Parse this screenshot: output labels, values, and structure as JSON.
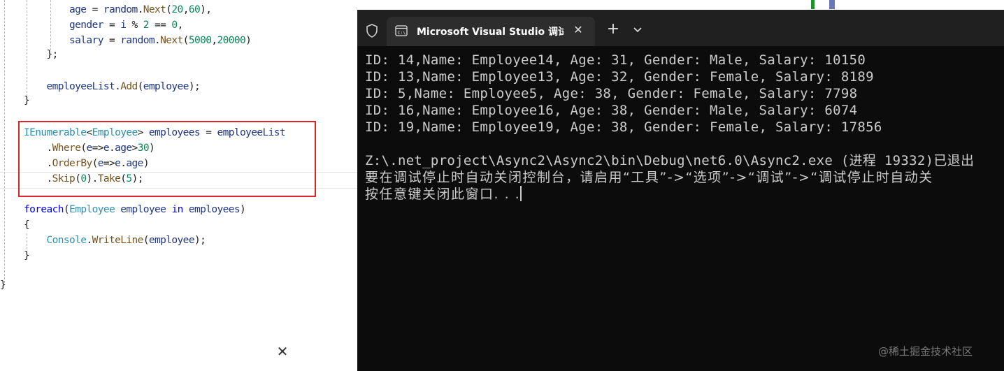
{
  "editor": {
    "lines": [
      {
        "indent": "        ",
        "parts": [
          [
            "var",
            "age"
          ],
          [
            "punc",
            " = "
          ],
          [
            "var",
            "random"
          ],
          [
            "punc",
            "."
          ],
          [
            "method",
            "Next"
          ],
          [
            "punc",
            "("
          ],
          [
            "num",
            "20"
          ],
          [
            "punc",
            ","
          ],
          [
            "num",
            "60"
          ],
          [
            "punc",
            "),"
          ]
        ]
      },
      {
        "indent": "        ",
        "parts": [
          [
            "var",
            "gender"
          ],
          [
            "punc",
            " = "
          ],
          [
            "var",
            "i"
          ],
          [
            "punc",
            " % "
          ],
          [
            "num",
            "2"
          ],
          [
            "punc",
            " == "
          ],
          [
            "num",
            "0"
          ],
          [
            "punc",
            ","
          ]
        ]
      },
      {
        "indent": "        ",
        "parts": [
          [
            "var",
            "salary"
          ],
          [
            "punc",
            " = "
          ],
          [
            "var",
            "random"
          ],
          [
            "punc",
            "."
          ],
          [
            "method",
            "Next"
          ],
          [
            "punc",
            "("
          ],
          [
            "num",
            "5000"
          ],
          [
            "punc",
            ","
          ],
          [
            "num",
            "20000"
          ],
          [
            "punc",
            ")"
          ]
        ]
      },
      {
        "indent": "    ",
        "parts": [
          [
            "punc",
            "};"
          ]
        ]
      },
      {
        "indent": "",
        "parts": []
      },
      {
        "indent": "    ",
        "parts": [
          [
            "var",
            "employeeList"
          ],
          [
            "punc",
            "."
          ],
          [
            "method",
            "Add"
          ],
          [
            "punc",
            "("
          ],
          [
            "var",
            "employee"
          ],
          [
            "punc",
            ");"
          ]
        ]
      },
      {
        "indent": "",
        "parts": [
          [
            "punc",
            "}"
          ]
        ]
      },
      {
        "indent": "",
        "parts": []
      },
      {
        "indent": "",
        "parts": [
          [
            "type",
            "IEnumerable"
          ],
          [
            "punc",
            "<"
          ],
          [
            "type",
            "Employee"
          ],
          [
            "punc",
            "> "
          ],
          [
            "var",
            "employees"
          ],
          [
            "punc",
            " = "
          ],
          [
            "var",
            "employeeList"
          ]
        ]
      },
      {
        "indent": "    ",
        "parts": [
          [
            "punc",
            "."
          ],
          [
            "method",
            "Where"
          ],
          [
            "punc",
            "("
          ],
          [
            "var",
            "e"
          ],
          [
            "punc",
            "=>"
          ],
          [
            "var",
            "e"
          ],
          [
            "punc",
            "."
          ],
          [
            "var",
            "age"
          ],
          [
            "punc",
            ">"
          ],
          [
            "num",
            "30"
          ],
          [
            "punc",
            ")"
          ]
        ]
      },
      {
        "indent": "    ",
        "parts": [
          [
            "punc",
            "."
          ],
          [
            "method",
            "OrderBy"
          ],
          [
            "punc",
            "("
          ],
          [
            "var",
            "e"
          ],
          [
            "punc",
            "=>"
          ],
          [
            "var",
            "e"
          ],
          [
            "punc",
            "."
          ],
          [
            "var",
            "age"
          ],
          [
            "punc",
            ")"
          ]
        ]
      },
      {
        "indent": "    ",
        "parts": [
          [
            "punc",
            "."
          ],
          [
            "method",
            "Skip"
          ],
          [
            "punc",
            "("
          ],
          [
            "num",
            "0"
          ],
          [
            "punc",
            ")."
          ],
          [
            "method",
            "Take"
          ],
          [
            "punc",
            "("
          ],
          [
            "num",
            "5"
          ],
          [
            "punc",
            ");"
          ]
        ]
      },
      {
        "indent": "",
        "parts": []
      },
      {
        "indent": "",
        "parts": [
          [
            "kw",
            "foreach"
          ],
          [
            "punc",
            "("
          ],
          [
            "type",
            "Employee"
          ],
          [
            "punc",
            " "
          ],
          [
            "var",
            "employee"
          ],
          [
            "punc",
            " "
          ],
          [
            "kw",
            "in"
          ],
          [
            "punc",
            " "
          ],
          [
            "var",
            "employees"
          ],
          [
            "punc",
            ")"
          ]
        ]
      },
      {
        "indent": "",
        "parts": [
          [
            "punc",
            "{"
          ]
        ]
      },
      {
        "indent": "    ",
        "parts": [
          [
            "type",
            "Console"
          ],
          [
            "punc",
            "."
          ],
          [
            "method",
            "WriteLine"
          ],
          [
            "punc",
            "("
          ],
          [
            "var",
            "employee"
          ],
          [
            "punc",
            ");"
          ]
        ]
      },
      {
        "indent": "",
        "parts": [
          [
            "punc",
            "}"
          ]
        ]
      }
    ],
    "final_brace": "}",
    "close_glyph": "✕"
  },
  "terminal": {
    "tab_title": "Microsoft Visual Studio 调试控制台",
    "tab_close_glyph": "✕",
    "new_tab_glyph": "+",
    "output": [
      "ID: 14,Name: Employee14, Age: 31, Gender: Male, Salary: 10150",
      "ID: 13,Name: Employee13, Age: 32, Gender: Female, Salary: 8189",
      "ID: 5,Name: Employee5, Age: 38, Gender: Female, Salary: 7798",
      "ID: 16,Name: Employee16, Age: 38, Gender: Male, Salary: 6074",
      "ID: 19,Name: Employee19, Age: 38, Gender: Female, Salary: 17856",
      "",
      "Z:\\.net_project\\Async2\\Async2\\bin\\Debug\\net6.0\\Async2.exe (进程 19332)已退出",
      "要在调试停止时自动关闭控制台，请启用“工具”->“选项”->“调试”->“调试停止时自动关",
      "按任意键关闭此窗口. . ."
    ],
    "icons": [
      "shield-icon",
      "console-icon",
      "chevron-down-icon"
    ]
  },
  "watermark": "@稀土掘金技术社区"
}
